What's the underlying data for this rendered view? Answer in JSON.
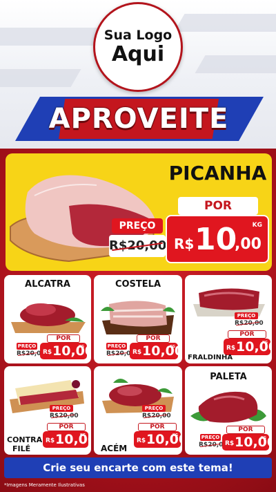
{
  "logo": {
    "line1": "Sua Logo",
    "line2": "Aqui"
  },
  "banner": {
    "title": "APROVEITE"
  },
  "hero": {
    "name": "PICANHA",
    "preco_label": "PREÇO",
    "old_price": "R$20,00",
    "por_label": "POR",
    "currency": "R$",
    "price_int": "10",
    "price_dec": ",00",
    "unit": "KG"
  },
  "products": [
    {
      "name": "ALCATRA",
      "preco_label": "PREÇO",
      "old_price": "R$20,00",
      "por_label": "POR",
      "currency": "R$",
      "price": "10,00",
      "unit": "KG"
    },
    {
      "name": "COSTELA",
      "preco_label": "PREÇO",
      "old_price": "R$20,00",
      "por_label": "POR",
      "currency": "R$",
      "price": "10,00",
      "unit": "KG"
    },
    {
      "name": "FRALDINHA",
      "preco_label": "PREÇO",
      "old_price": "R$20,00",
      "por_label": "POR",
      "currency": "R$",
      "price": "10,00",
      "unit": "KG"
    },
    {
      "name_line1": "CONTRA",
      "name_line2": "FILÉ",
      "preco_label": "PREÇO",
      "old_price": "R$20,00",
      "por_label": "POR",
      "currency": "R$",
      "price": "10,00",
      "unit": "KG"
    },
    {
      "name": "ACÉM",
      "preco_label": "PREÇO",
      "old_price": "R$20,00",
      "por_label": "POR",
      "currency": "R$",
      "price": "10,00",
      "unit": "KG"
    },
    {
      "name": "PALETA",
      "preco_label": "PREÇO",
      "old_price": "R$20,00",
      "por_label": "POR",
      "currency": "R$",
      "price": "10,00",
      "unit": "KG"
    }
  ],
  "cta": {
    "label": "Crie seu encarte com este tema!"
  },
  "footnote": "*Imagens Meramente Ilustrativas",
  "colors": {
    "red": "#c4161e",
    "blue": "#1f3fb5",
    "yellow": "#f7d417"
  }
}
